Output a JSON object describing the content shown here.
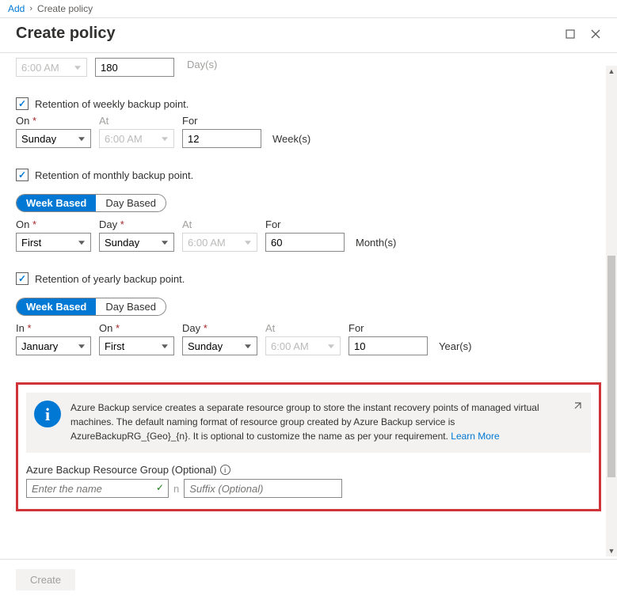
{
  "breadcrumb": {
    "add": "Add",
    "current": "Create policy"
  },
  "panel_title": "Create policy",
  "daily": {
    "time": "6:00 AM",
    "for": "180",
    "unit": "Day(s)"
  },
  "weekly": {
    "checkbox_label": "Retention of weekly backup point.",
    "on_label": "On",
    "at_label": "At",
    "for_label": "For",
    "on": "Sunday",
    "at": "6:00 AM",
    "for": "12",
    "unit": "Week(s)"
  },
  "monthly": {
    "checkbox_label": "Retention of monthly backup point.",
    "pill_week": "Week Based",
    "pill_day": "Day Based",
    "on_label": "On",
    "day_label": "Day",
    "at_label": "At",
    "for_label": "For",
    "on": "First",
    "day": "Sunday",
    "at": "6:00 AM",
    "for": "60",
    "unit": "Month(s)"
  },
  "yearly": {
    "checkbox_label": "Retention of yearly backup point.",
    "pill_week": "Week Based",
    "pill_day": "Day Based",
    "in_label": "In",
    "on_label": "On",
    "day_label": "Day",
    "at_label": "At",
    "for_label": "For",
    "in": "January",
    "on": "First",
    "day": "Sunday",
    "at": "6:00 AM",
    "for": "10",
    "unit": "Year(s)"
  },
  "info_text": "Azure Backup service creates a separate resource group to store the instant recovery points of managed virtual machines. The default naming format of resource group created by Azure Backup service is AzureBackupRG_{Geo}_{n}. It is optional to customize the name as per your requirement.",
  "info_link": "Learn More",
  "rg": {
    "label": "Azure Backup Resource Group (Optional)",
    "name_placeholder": "Enter the name",
    "sep": "n",
    "suffix_placeholder": "Suffix (Optional)"
  },
  "create_label": "Create"
}
